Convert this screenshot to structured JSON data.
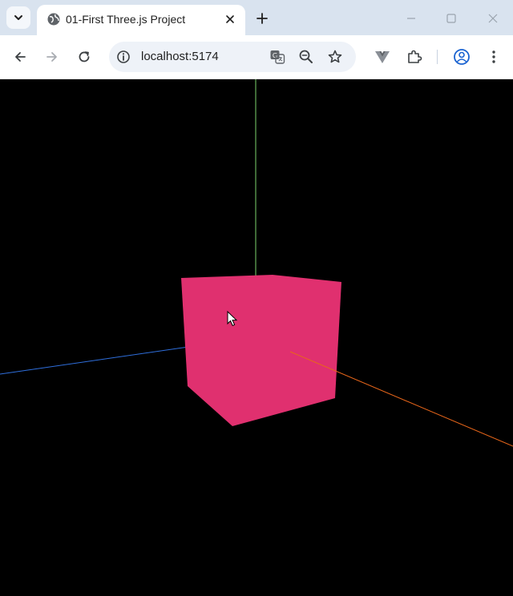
{
  "browser": {
    "tab": {
      "title": "01-First Three.js Project",
      "favicon_icon": "globe-icon"
    },
    "omnibox": {
      "url": "localhost:5174"
    },
    "icons": {
      "tab_search": "chevron-down-icon",
      "close": "close-icon",
      "new_tab": "plus-icon",
      "back": "back-arrow-icon",
      "forward": "forward-arrow-icon",
      "reload": "reload-icon",
      "site_info": "info-icon",
      "translate": "translate-icon",
      "zoom": "zoom-out-icon",
      "bookmark": "star-icon",
      "extension_vue": "vue-devtools-icon",
      "extensions": "puzzle-icon",
      "profile": "profile-icon"
    }
  },
  "scene": {
    "background": "#000000",
    "cube_color": "#e0306f",
    "axes": {
      "x_color": "#e8661a",
      "y_color": "#7cd66b",
      "z_color": "#2f6fdd"
    }
  }
}
